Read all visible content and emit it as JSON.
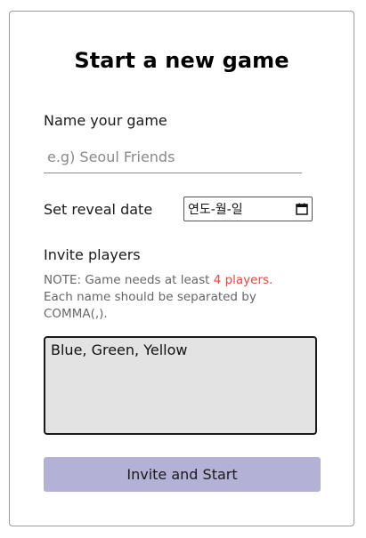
{
  "form": {
    "title": "Start a new game",
    "name": {
      "label": "Name your game",
      "placeholder": "e.g) Seoul Friends",
      "value": ""
    },
    "reveal_date": {
      "label": "Set reveal date",
      "value_display": "연도-월-일",
      "icon": "calendar-icon"
    },
    "invite": {
      "label": "Invite players",
      "note_prefix": "NOTE: Game needs at least ",
      "note_highlight": "4 players.",
      "note_suffix": " Each name should be separated by COMMA(,).",
      "value": "Blue, Green, Yellow",
      "highlight_color": "#e8483e"
    },
    "submit_label": "Invite and Start",
    "submit_color": "#b3b1d6"
  }
}
